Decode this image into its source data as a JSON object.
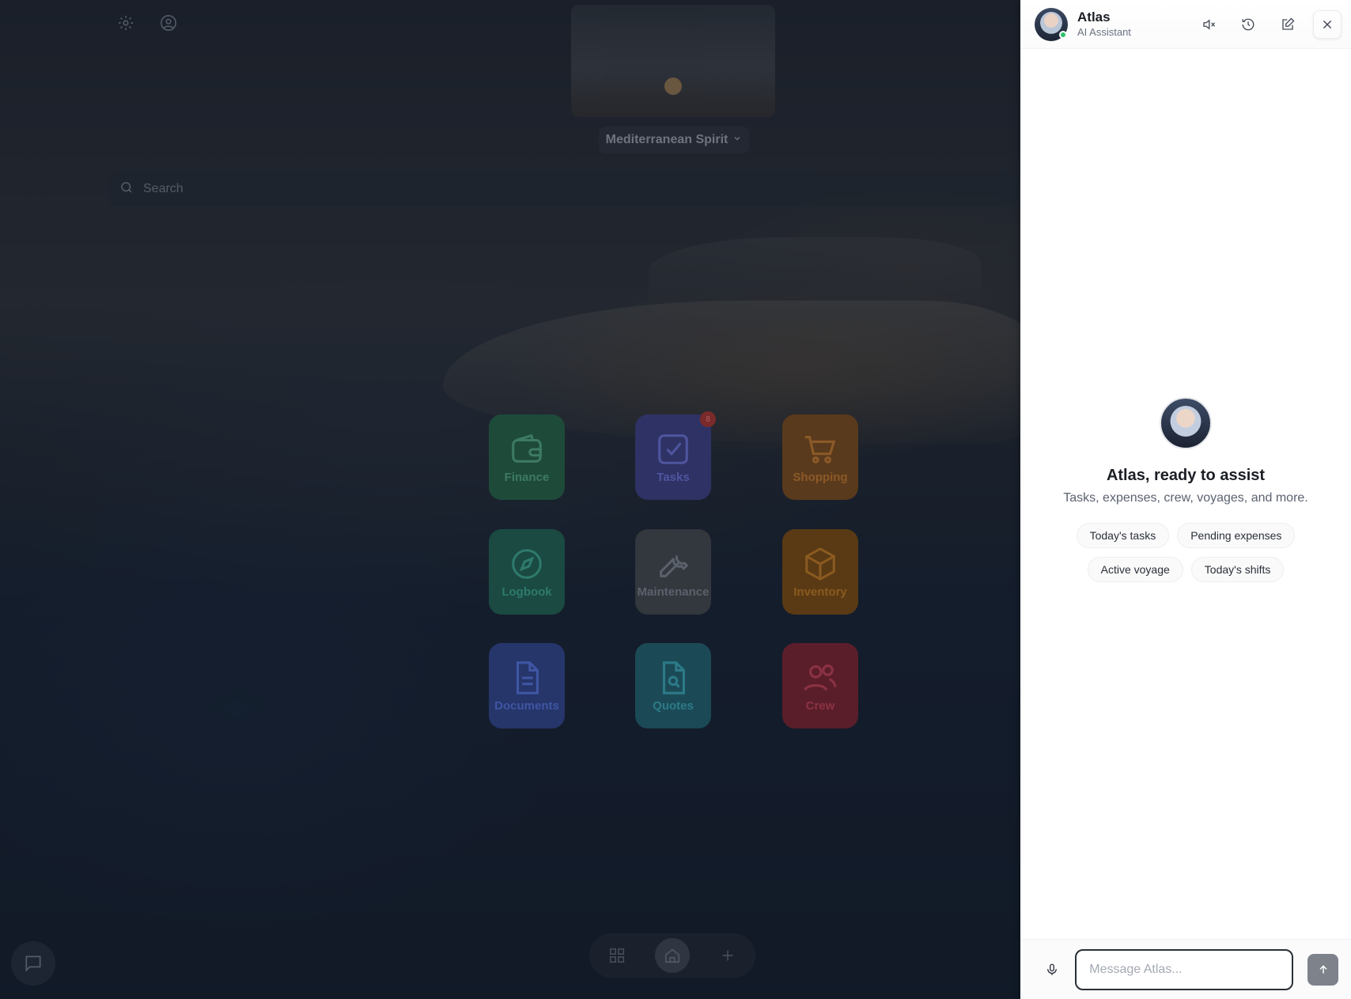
{
  "background": {
    "vessel_selector": {
      "label": "Mediterranean Spirit",
      "icon": "chevron-down-icon"
    },
    "search": {
      "placeholder": "Search"
    },
    "top_icons": [
      "settings-icon",
      "account-icon"
    ],
    "tiles": [
      {
        "label": "Finance",
        "icon": "wallet-icon"
      },
      {
        "label": "Tasks",
        "icon": "check-square-icon",
        "badge": "8"
      },
      {
        "label": "Shopping",
        "icon": "cart-icon"
      },
      {
        "label": "Logbook",
        "icon": "compass-icon"
      },
      {
        "label": "Maintenance",
        "icon": "wrench-icon"
      },
      {
        "label": "Inventory",
        "icon": "box-icon"
      },
      {
        "label": "Documents",
        "icon": "document-icon"
      },
      {
        "label": "Quotes",
        "icon": "file-search-icon"
      },
      {
        "label": "Crew",
        "icon": "users-icon"
      }
    ],
    "dock": [
      "grid-icon",
      "home-icon",
      "plus-icon"
    ],
    "chat_button_icon": "chat-icon"
  },
  "assistant": {
    "name": "Atlas",
    "role": "AI Assistant",
    "status_color": "#2fbf6b",
    "header_actions": [
      "mute-icon",
      "history-icon",
      "new-chat-icon",
      "close-icon"
    ],
    "welcome_title": "Atlas, ready to assist",
    "welcome_subtitle": "Tasks, expenses, crew, voyages, and more.",
    "suggestions": [
      [
        "Today's tasks",
        "Pending expenses"
      ],
      [
        "Active voyage",
        "Today's shifts"
      ]
    ],
    "input_placeholder": "Message Atlas...",
    "input_value": ""
  }
}
